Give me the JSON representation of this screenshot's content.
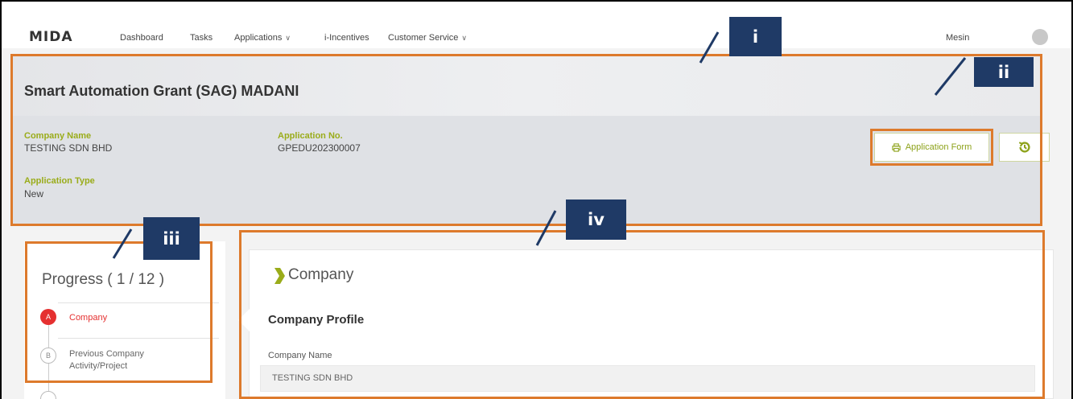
{
  "nav": {
    "logo": "MIDA",
    "items": [
      {
        "label": "Dashboard",
        "dropdown": false
      },
      {
        "label": "Tasks",
        "dropdown": false
      },
      {
        "label": "Applications",
        "dropdown": true
      },
      {
        "label": "i-Incentives",
        "dropdown": false
      },
      {
        "label": "Customer Service",
        "dropdown": true
      }
    ],
    "user_name": "Mesin"
  },
  "header": {
    "title": "Smart Automation Grant (SAG) MADANI",
    "company_name_label": "Company Name",
    "company_name_value": "TESTING SDN BHD",
    "application_no_label": "Application No.",
    "application_no_value": "GPEDU202300007",
    "application_type_label": "Application Type",
    "application_type_value": "New",
    "application_form_button": "Application Form"
  },
  "progress": {
    "title": "Progress ( 1 / 12 )",
    "steps": [
      {
        "letter": "A",
        "label": "Company",
        "active": true
      },
      {
        "letter": "B",
        "label_line1": "Previous Company",
        "label_line2": "Activity/Project",
        "active": false
      }
    ]
  },
  "content": {
    "section_title": "Company",
    "subsection_title": "Company Profile",
    "company_name_label": "Company Name",
    "company_name_value": "TESTING SDN BHD"
  },
  "annotations": [
    "i",
    "ii",
    "iii",
    "iv"
  ],
  "colors": {
    "accent_olive": "#9aac1a",
    "active_step_red": "#e53030",
    "annotation_orange": "#dd7a2c",
    "annotation_badge_navy": "#1f3a66"
  }
}
